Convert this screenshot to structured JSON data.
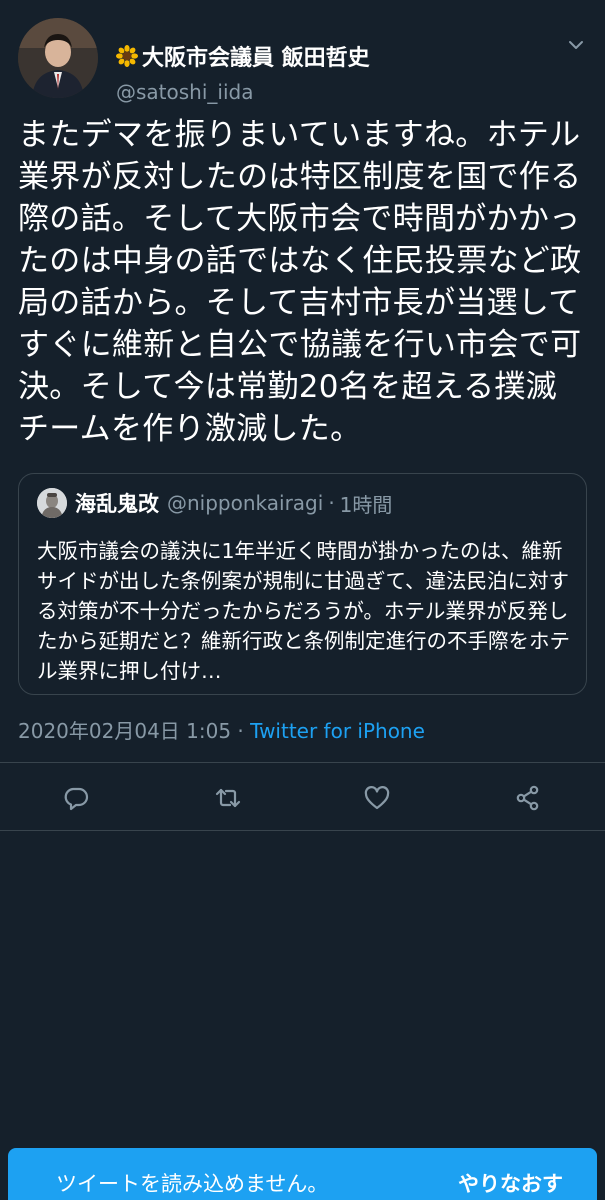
{
  "tweet": {
    "display_name": "大阪市会議員 飯田哲史",
    "handle": "@satoshi_iida",
    "text": "またデマを振りまいていますね。ホテル業界が反対したのは特区制度を国で作る際の話。そして大阪市会で時間がかかったのは中身の話ではなく住民投票など政局の話から。そして吉村市長が当選してすぐに維新と自公で協議を行い市会で可決。そして今は常勤20名を超える撲滅チームを作り激減した。",
    "date": "2020年02月04日 1:05",
    "separator": " · ",
    "source": "Twitter for iPhone"
  },
  "quote": {
    "name": "海乱鬼改",
    "handle": "@nipponkairagi",
    "dot": "·",
    "time": "1時間",
    "text": "大阪市議会の議決に1年半近く時間が掛かったのは、維新サイドが出した条例案が規制に甘過ぎて、違法民泊に対する対策が不十分だったからだろうが。ホテル業界が反発したから延期だと？維新行政と条例制定進行の不手際をホテル業界に押し付け…"
  },
  "actions": {
    "icons": [
      "reply-icon",
      "retweet-icon",
      "like-icon",
      "share-icon"
    ]
  },
  "banner": {
    "message": "ツイートを読み込めません。",
    "retry": "やりなおす"
  },
  "colors": {
    "background": "#15202b",
    "accent": "#1da1f2",
    "secondary_text": "#8899a6",
    "border": "#38444d"
  }
}
